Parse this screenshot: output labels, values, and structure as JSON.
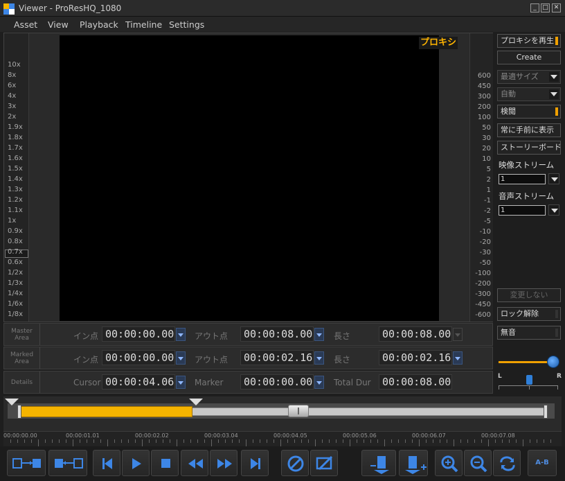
{
  "window": {
    "title": "Viewer - ProResHQ_1080"
  },
  "menu": [
    "Asset",
    "View",
    "Playback",
    "Timeline",
    "Settings"
  ],
  "viewer": {
    "proxy_badge": "プロキシ",
    "speed_labels": [
      "10x",
      "8x",
      "6x",
      "4x",
      "3x",
      "2x",
      "1.9x",
      "1.8x",
      "1.7x",
      "1.6x",
      "1.5x",
      "1.4x",
      "1.3x",
      "1.2x",
      "1.1x",
      "1x",
      "0.9x",
      "0.8x",
      "0.7x",
      "0.6x",
      "1/2x",
      "1/3x",
      "1/4x",
      "1/6x",
      "1/8x"
    ],
    "current_speed": "1x",
    "meter_labels": [
      "600",
      "450",
      "300",
      "200",
      "100",
      "50",
      "30",
      "20",
      "10",
      "5",
      "2",
      "1",
      "-1",
      "-2",
      "-5",
      "-10",
      "-20",
      "-30",
      "-50",
      "-100",
      "-200",
      "-300",
      "-450",
      "-600"
    ]
  },
  "right_panel": {
    "proxy_play": "プロキシを再生",
    "create": "Create",
    "size_select": "最適サイズ",
    "auto_select": "自動",
    "review": "検閲",
    "always_on_top": "常に手前に表示",
    "storyboard": "ストーリーボード追",
    "video_stream_label": "映像ストリーム",
    "video_stream_value": "1",
    "audio_stream_label": "音声ストリーム",
    "audio_stream_value": "1",
    "no_change": "変更しない",
    "unlock": "ロック解除",
    "mute": "無音",
    "pan_left": "L",
    "pan_right": "R"
  },
  "time_rows": [
    {
      "head": "Master Area",
      "l1": "イン点",
      "v1": "00:00:00.00",
      "l2": "アウト点",
      "v2": "00:00:08.00",
      "l3": "長さ",
      "v3": "00:00:08.00"
    },
    {
      "head": "Marked Area",
      "l1": "イン点",
      "v1": "00:00:00.00",
      "l2": "アウト点",
      "v2": "00:00:02.16",
      "l3": "長さ",
      "v3": "00:00:02.16"
    },
    {
      "head": "Details",
      "l1": "Cursor",
      "v1": "00:00:04.06",
      "l2": "Marker",
      "v2": "00:00:00.00",
      "l3": "Total Dur",
      "v3": "00:00:08.00"
    }
  ],
  "timeline": {
    "ruler_labels": [
      "00:00:00.00",
      "00:00:01.01",
      "00:00:02.02",
      "00:00:03.04",
      "00:00:04.05",
      "00:00:05.06",
      "00:00:06.07",
      "00:00:07.08"
    ],
    "marked_fraction": 0.33,
    "playhead_fraction": 0.53
  },
  "toolbar": {
    "ab_label": "A-B"
  },
  "colors": {
    "accent": "#f5b400",
    "blue": "#3d86e6",
    "bg": "#1e1e1e"
  }
}
